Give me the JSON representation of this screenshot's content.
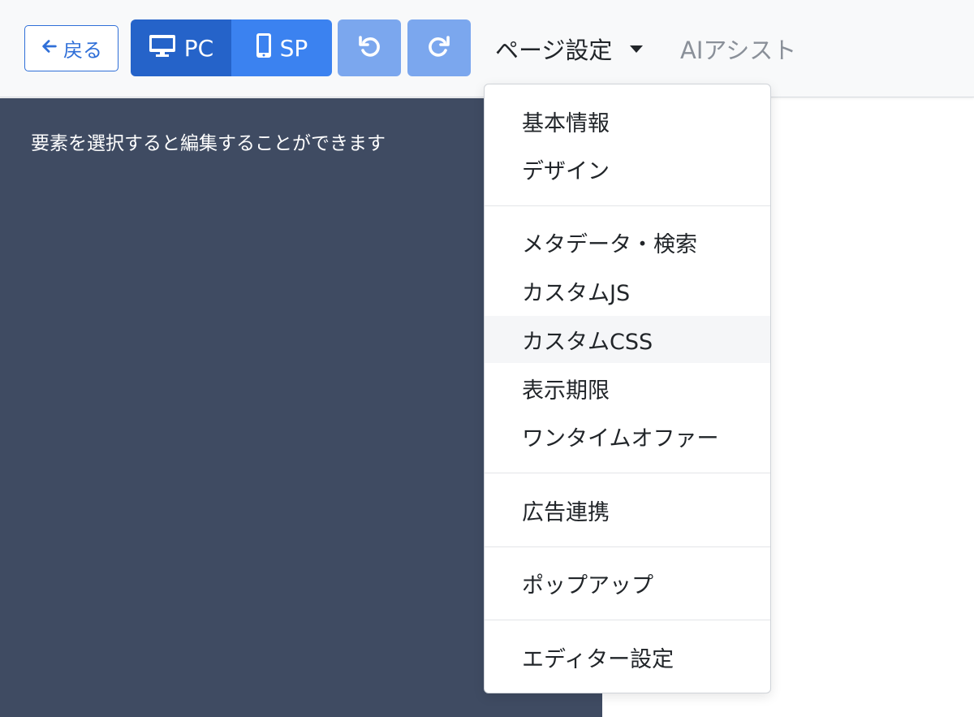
{
  "toolbar": {
    "back_label": "戻る",
    "device_pc_label": "PC",
    "device_sp_label": "SP",
    "page_settings_label": "ページ設定",
    "ai_assist_label": "AIアシスト"
  },
  "editor": {
    "hint": "要素を選択すると編集することができます"
  },
  "dropdown": {
    "groups": [
      [
        "基本情報",
        "デザイン"
      ],
      [
        "メタデータ・検索",
        "カスタムJS",
        "カスタムCSS",
        "表示期限",
        "ワンタイムオファー"
      ],
      [
        "広告連携"
      ],
      [
        "ポップアップ"
      ],
      [
        "エディター設定"
      ]
    ]
  },
  "colors": {
    "primary": "#2f6fd8",
    "device_active": "#2563c9",
    "device_inactive": "#3b82f0",
    "history_button": "#7ba7ee",
    "editor_bg": "#3f4b62"
  }
}
